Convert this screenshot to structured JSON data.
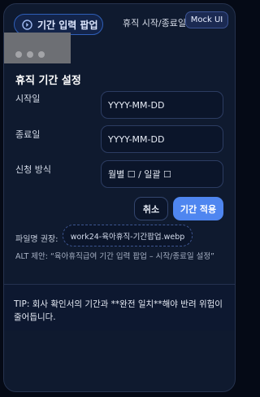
{
  "header": {
    "popup_button_label": "기간 입력 팝업",
    "title": "휴직 시작/종료일",
    "badge": "Mock UI"
  },
  "form": {
    "section_title": "휴직 기간 설정",
    "start_label": "시작일",
    "start_value": "YYYY-MM-DD",
    "end_label": "종료일",
    "end_value": "YYYY-MM-DD",
    "method_label": "신청 방식",
    "method_value": "월별 ☐ / 일괄 ☐"
  },
  "actions": {
    "cancel_label": "취소",
    "apply_label": "기간 적용"
  },
  "meta": {
    "filename_label": "파일명 권장:",
    "filename": "work24-육아휴직-기간팝업.webp",
    "alt_text": "ALT 제안: “육아휴직급여 기간 입력 팝업 – 시작/종료일 설정”"
  },
  "tip": {
    "text": "TIP: 회사 확인서의 기간과 **완전 일치**해야 반려 위험이 줄어듭니다."
  },
  "colors": {
    "accent": "#4f86f0",
    "background": "#0f1a2f"
  }
}
